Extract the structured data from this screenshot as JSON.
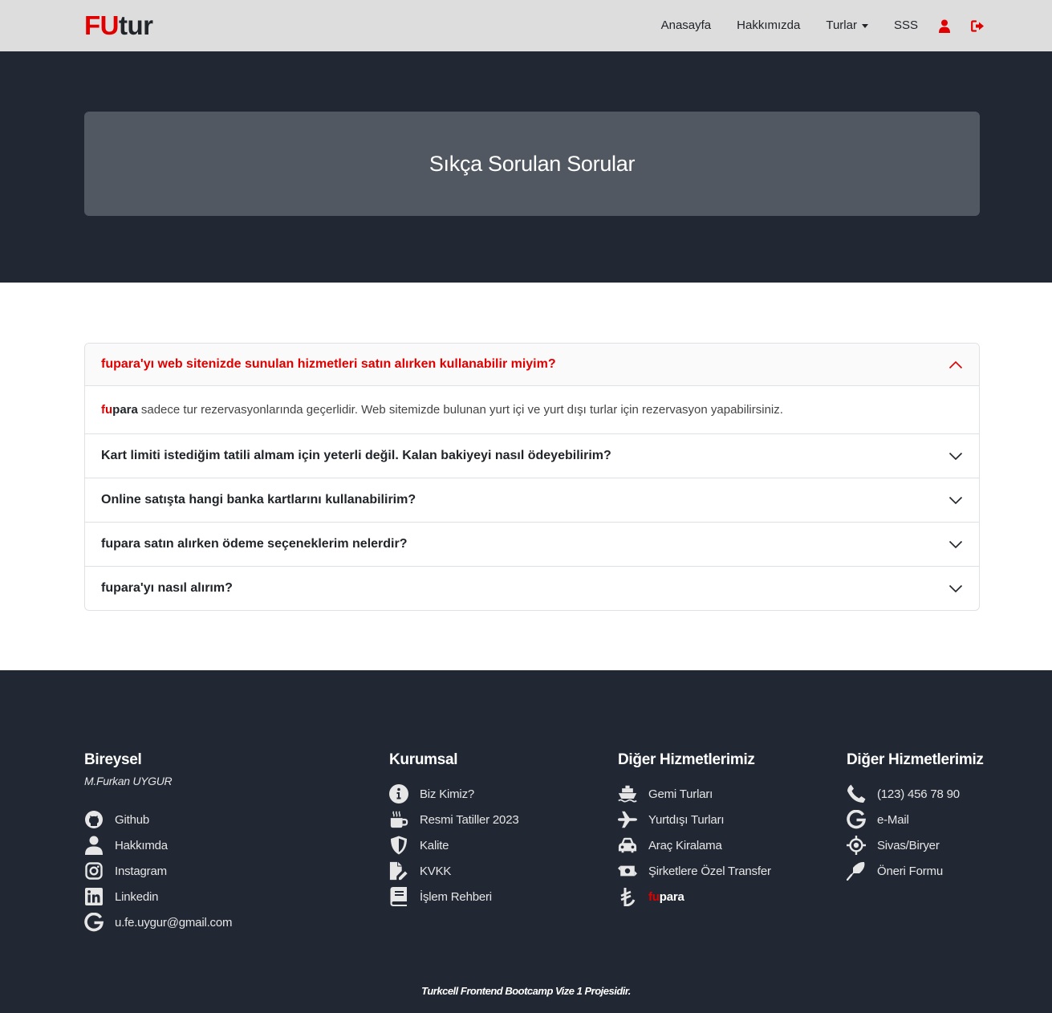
{
  "brand": {
    "part1": "FU",
    "part2": "tur"
  },
  "nav": {
    "items": [
      "Anasayfa",
      "Hakkımızda",
      "Turlar",
      "SSS"
    ]
  },
  "hero": {
    "title": "Sıkça Sorulan Sorular"
  },
  "faq": {
    "items": [
      {
        "question": "fupara'yı web sitenizde sunulan hizmetleri satın alırken kullanabilir miyim?",
        "open": true
      },
      {
        "question": "Kart limiti istediğim tatili almam için yeterli değil. Kalan bakiyeyi nasıl ödeyebilirim?",
        "open": false
      },
      {
        "question": "Online satışta hangi banka kartlarını kullanabilirim?",
        "open": false
      },
      {
        "question": "fupara satın alırken ödeme seçeneklerim nelerdir?",
        "open": false
      },
      {
        "question": "fupara'yı nasıl alırım?",
        "open": false
      }
    ],
    "open_answer": {
      "brand_fu": "fu",
      "brand_para": "para",
      "text": "sadece tur rezervasyonlarında geçerlidir. Web sitemizde bulunan yurt içi ve yurt dışı turlar için rezervasyon yapabilirsiniz."
    }
  },
  "footer": {
    "col1": {
      "title": "Bireysel",
      "subtitle": "M.Furkan UYGUR",
      "links": [
        {
          "icon": "github-icon",
          "label": "Github"
        },
        {
          "icon": "user-icon",
          "label": "Hakkımda"
        },
        {
          "icon": "instagram-icon",
          "label": "Instagram"
        },
        {
          "icon": "linkedin-icon",
          "label": "Linkedin"
        },
        {
          "icon": "google-icon",
          "label": "u.fe.uygur@gmail.com"
        }
      ]
    },
    "col2": {
      "title": "Kurumsal",
      "links": [
        {
          "icon": "info-icon",
          "label": "Biz Kimiz?"
        },
        {
          "icon": "mug-icon",
          "label": "Resmi Tatiller 2023"
        },
        {
          "icon": "shield-icon",
          "label": "Kalite"
        },
        {
          "icon": "file-pen-icon",
          "label": "KVKK"
        },
        {
          "icon": "book-icon",
          "label": "İşlem Rehberi"
        }
      ]
    },
    "col3": {
      "title": "Diğer Hizmetlerimiz",
      "links": [
        {
          "icon": "ship-icon",
          "label": "Gemi Turları"
        },
        {
          "icon": "plane-icon",
          "label": "Yurtdışı Turları"
        },
        {
          "icon": "car-icon",
          "label": "Araç Kiralama"
        },
        {
          "icon": "money-transfer-icon",
          "label": "Şirketlere Özel Transfer"
        },
        {
          "icon": "lira-icon",
          "label_fu": "fu",
          "label_para": "para"
        }
      ]
    },
    "col4": {
      "title": "Diğer Hizmetlerimiz",
      "links": [
        {
          "icon": "phone-icon",
          "label": "(123) 456 78 90"
        },
        {
          "icon": "google-icon",
          "label": "e-Mail"
        },
        {
          "icon": "location-crosshairs-icon",
          "label": "Sivas/Biryer"
        },
        {
          "icon": "feather-icon",
          "label": "Öneri Formu"
        }
      ]
    },
    "copyright": "Turkcell Frontend Bootcamp Vize 1 Projesidir."
  },
  "colors": {
    "accent": "#e00000",
    "dark": "#212733",
    "hero_box": "#525862",
    "navbar": "#dddddd"
  }
}
